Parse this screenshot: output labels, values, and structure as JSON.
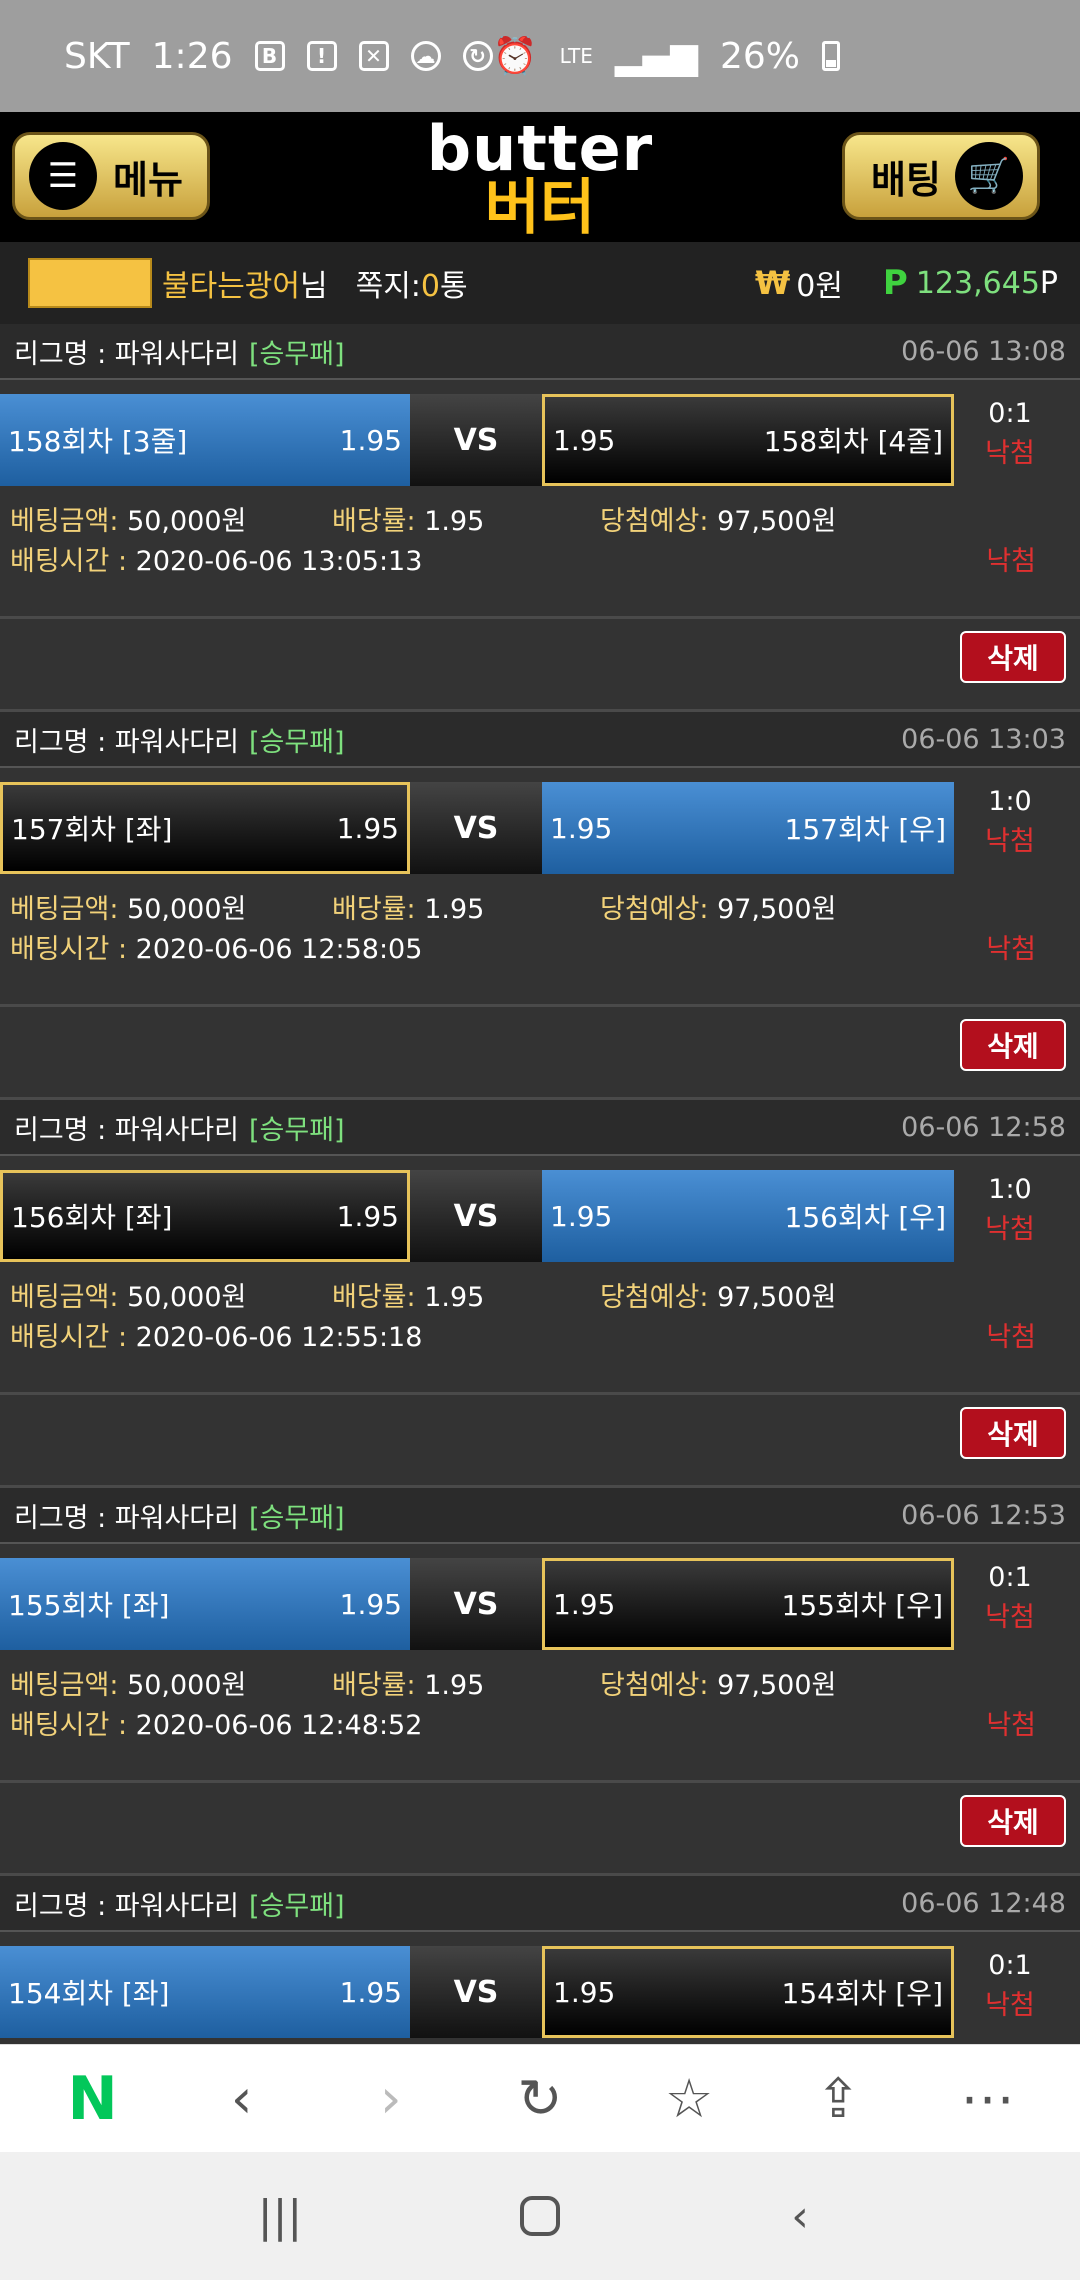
{
  "status_bar": {
    "carrier": "SKT",
    "time": "1:26",
    "network": "LTE",
    "battery": "26%"
  },
  "header": {
    "menu_label": "메뉴",
    "logo_en": "butter",
    "logo_ko": "버터",
    "bet_label": "배팅"
  },
  "user": {
    "name": "불타는광어",
    "suffix": "님",
    "message_label": "쪽지:",
    "message_count": "0",
    "message_unit": "통",
    "won_symbol": "₩",
    "money": "0원",
    "points_symbol": "P",
    "points": "123,645",
    "points_unit": "P"
  },
  "labels": {
    "league": "리그명 : 파워사다리",
    "vs": "VS",
    "bet_amount": "베팅금액:",
    "odds": "배당률:",
    "expected": "당첨예상:",
    "bet_time": "배팅시간 :",
    "delete": "삭제"
  },
  "bets": [
    {
      "tag": "[승무패]",
      "time": "06-06 13:08",
      "left_name": "158회차 [3줄]",
      "left_odd": "1.95",
      "right_odd": "1.95",
      "right_name": "158회차 [4줄]",
      "score": "0:1",
      "result": "낙첨",
      "amount": "50,000원",
      "odds": "1.95",
      "expected": "97,500원",
      "bet_time": "2020-06-06 13:05:13",
      "final_result": "낙첨"
    },
    {
      "tag": "[승무패]",
      "time": "06-06 13:03",
      "left_name": "157회차 [좌]",
      "left_odd": "1.95",
      "right_odd": "1.95",
      "right_name": "157회차 [우]",
      "score": "1:0",
      "result": "낙첨",
      "amount": "50,000원",
      "odds": "1.95",
      "expected": "97,500원",
      "bet_time": "2020-06-06 12:58:05",
      "final_result": "낙첨"
    },
    {
      "tag": "[승무패]",
      "time": "06-06 12:58",
      "left_name": "156회차 [좌]",
      "left_odd": "1.95",
      "right_odd": "1.95",
      "right_name": "156회차 [우]",
      "score": "1:0",
      "result": "낙첨",
      "amount": "50,000원",
      "odds": "1.95",
      "expected": "97,500원",
      "bet_time": "2020-06-06 12:55:18",
      "final_result": "낙첨"
    },
    {
      "tag": "[승무패]",
      "time": "06-06 12:53",
      "left_name": "155회차 [좌]",
      "left_odd": "1.95",
      "right_odd": "1.95",
      "right_name": "155회차 [우]",
      "score": "0:1",
      "result": "낙첨",
      "amount": "50,000원",
      "odds": "1.95",
      "expected": "97,500원",
      "bet_time": "2020-06-06 12:48:52",
      "final_result": "낙첨"
    },
    {
      "tag": "[승무패]",
      "time": "06-06 12:48",
      "left_name": "154회차 [좌]",
      "left_odd": "1.95",
      "right_odd": "1.95",
      "right_name": "154회차 [우]",
      "score": "0:1",
      "result": "낙첨"
    }
  ],
  "browser_toolbar": {
    "naver": "N",
    "icons": [
      "naver-icon",
      "back-icon",
      "forward-icon",
      "reload-icon",
      "bookmark-star-icon",
      "share-icon",
      "more-icon"
    ]
  },
  "colors": {
    "gold": "#f5c242",
    "green": "#7ee07e",
    "red": "#e03030",
    "blue": "#2e72b8",
    "delete_red": "#b30f1d"
  }
}
